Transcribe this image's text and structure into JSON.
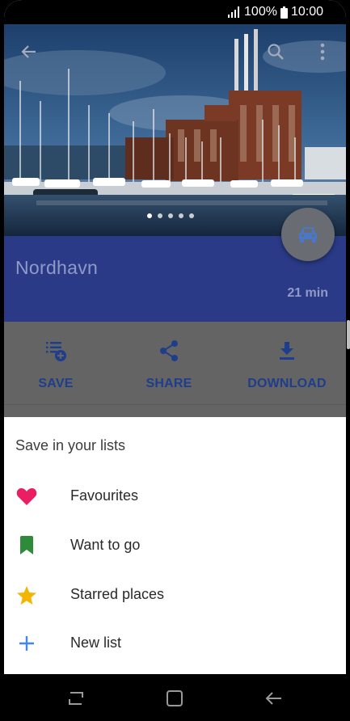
{
  "status": {
    "battery": "100%",
    "time": "10:00"
  },
  "header": {
    "back_icon": "arrow-back-icon",
    "search_icon": "search-icon",
    "menu_icon": "more-vert-icon"
  },
  "place": {
    "name": "Nordhavn",
    "travel_time": "21 min",
    "travel_mode_icon": "car-icon"
  },
  "gallery": {
    "page_count": 5,
    "active_index": 0
  },
  "actions": [
    {
      "label": "SAVE",
      "icon": "playlist-add-icon"
    },
    {
      "label": "SHARE",
      "icon": "share-icon"
    },
    {
      "label": "DOWNLOAD",
      "icon": "download-icon"
    }
  ],
  "save_sheet": {
    "title": "Save in your lists",
    "items": [
      {
        "label": "Favourites",
        "icon": "heart-icon",
        "color": "#e91e63"
      },
      {
        "label": "Want to go",
        "icon": "bookmark-icon",
        "color": "#2e8b3a"
      },
      {
        "label": "Starred places",
        "icon": "star-icon",
        "color": "#f4b400"
      },
      {
        "label": "New list",
        "icon": "plus-icon",
        "color": "#4285f4"
      }
    ]
  },
  "colors": {
    "band": "#2a3a86",
    "action_label": "#1e3e8c",
    "scrim": "#646464"
  }
}
